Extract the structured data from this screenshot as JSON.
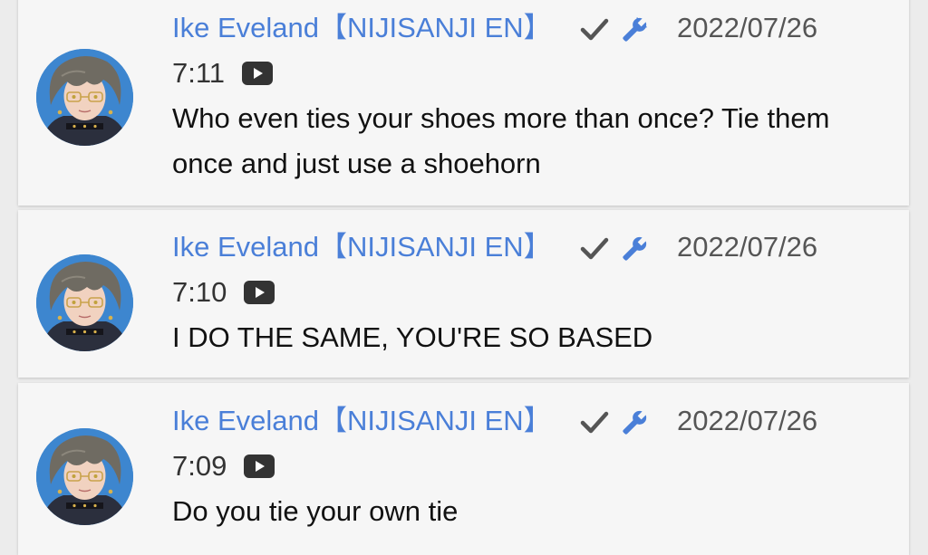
{
  "comments": [
    {
      "author": "Ike Eveland【NIJISANJI EN】",
      "date": "2022/07/26",
      "time": "7:11",
      "text": "Who even ties your shoes more than once? Tie them once and just use a shoehorn"
    },
    {
      "author": "Ike Eveland【NIJISANJI EN】",
      "date": "2022/07/26",
      "time": "7:10",
      "text": "I DO THE SAME, YOU'RE SO BASED"
    },
    {
      "author": "Ike Eveland【NIJISANJI EN】",
      "date": "2022/07/26",
      "time": "7:09",
      "text": "Do you tie your own tie"
    }
  ],
  "badges": [
    "verified-check-icon",
    "moderator-wrench-icon"
  ],
  "colors": {
    "author": "#4a7fd8",
    "badge_wrench": "#4a7fd8",
    "badge_check": "#555555",
    "card_bg": "#f6f6f6",
    "page_bg": "#ececec",
    "avatar_bg": "#3d86cf"
  }
}
